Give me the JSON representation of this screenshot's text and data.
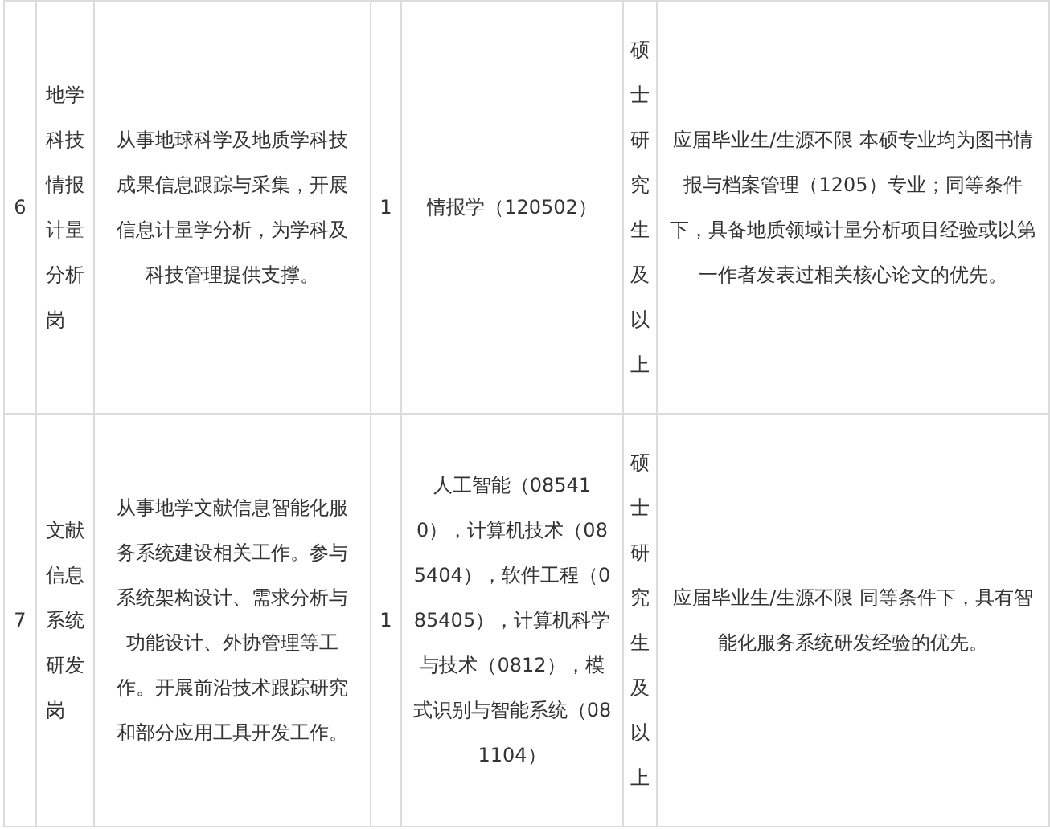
{
  "table": {
    "rows": [
      {
        "number": "6",
        "position": "地学科技情报计量分析岗",
        "duties": "从事地球科学及地质学科技成果信息跟踪与采集，开展信息计量学分析，为学科及科技管理提供支撑。",
        "headcount": "1",
        "major": "情报学（120502）",
        "degree": "硕士研究生及以上",
        "requirements": "应届毕业生/生源不限 本硕专业均为图书情报与档案管理（1205）专业；同等条件下，具备地质领域计量分析项目经验或以第一作者发表过相关核心论文的优先。"
      },
      {
        "number": "7",
        "position": "文献信息系统研发岗",
        "duties": "从事地学文献信息智能化服务系统建设相关工作。参与系统架构设计、需求分析与功能设计、外协管理等工作。开展前沿技术跟踪研究和部分应用工具开发工作。",
        "headcount": "1",
        "major": "人工智能（085410），计算机技术（085404），软件工程（085405），计算机科学与技术（0812），模式识别与智能系统（081104）",
        "degree": "硕士研究生及以上",
        "requirements": "应届毕业生/生源不限 同等条件下，具有智能化服务系统研发经验的优先。"
      }
    ]
  }
}
